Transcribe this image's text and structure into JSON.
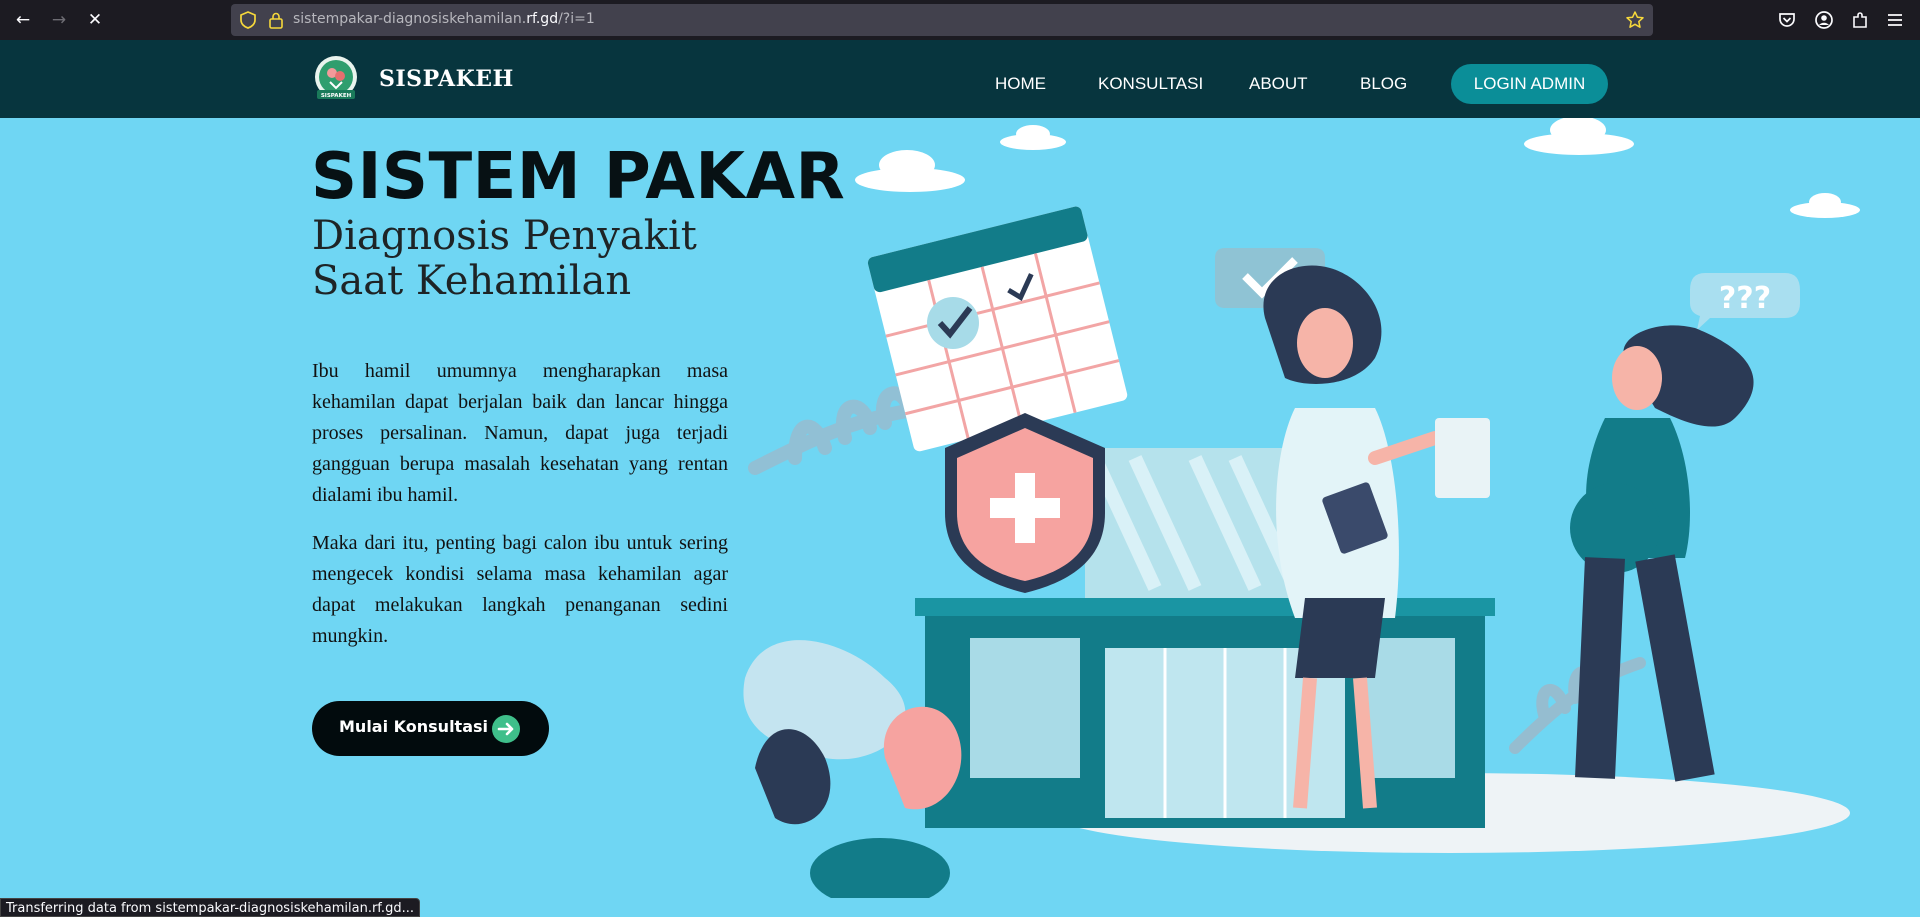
{
  "browser": {
    "url_prefix": "sistempakar-diagnosiskehamilan.",
    "url_domain": "rf.gd",
    "url_path": "/?i=1",
    "status_text": "Transferring data from sistempakar-diagnosiskehamilan.rf.gd..."
  },
  "site": {
    "logo_text": "SISPAKEH",
    "brand": "SISPAKEH",
    "menu": [
      "HOME",
      "KONSULTASI",
      "ABOUT",
      "BLOG"
    ],
    "login_label": "LOGIN ADMIN"
  },
  "hero": {
    "title": "SISTEM PAKAR",
    "subtitle_line1": "Diagnosis Penyakit",
    "subtitle_line2": "Saat Kehamilan",
    "paragraph1": "Ibu hamil umumnya mengharapkan masa kehamilan dapat berjalan baik dan lancar hingga proses persalinan. Namun, dapat juga terjadi gangguan berupa masalah kesehatan yang rentan dialami ibu hamil.",
    "paragraph2": "Maka dari itu, penting bagi calon ibu untuk sering mengecek kondisi selama masa kehamilan agar dapat melakukan langkah penanganan sedini mungkin.",
    "cta_label": "Mulai Konsultasi",
    "bubble_text": "???"
  },
  "colors": {
    "header_bg": "#07353e",
    "page_bg": "#6fd6f3",
    "accent": "#0b8e98"
  }
}
